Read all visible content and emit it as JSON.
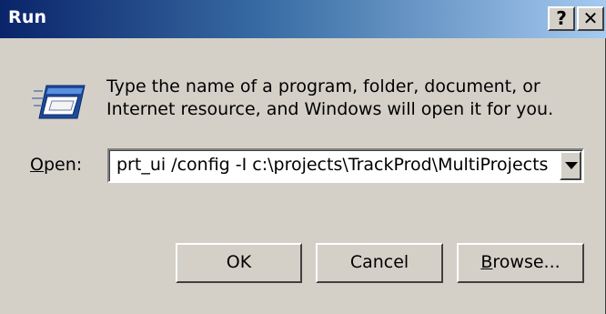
{
  "window": {
    "title": "Run",
    "help_label": "?",
    "close_label": "✕"
  },
  "description": {
    "line1": "Type the name of a program, folder, document, or",
    "line2": "Internet resource, and Windows will open it for you."
  },
  "open": {
    "label_underlined": "O",
    "label_rest": "pen:",
    "value": "prt_ui /config -I c:\\projects\\TrackProd\\MultiProjects"
  },
  "buttons": {
    "ok": "OK",
    "cancel": "Cancel",
    "browse_underlined": "B",
    "browse_rest": "rowse..."
  },
  "icons": {
    "run": "run-program-icon",
    "dropdown": "chevron-down-icon"
  }
}
